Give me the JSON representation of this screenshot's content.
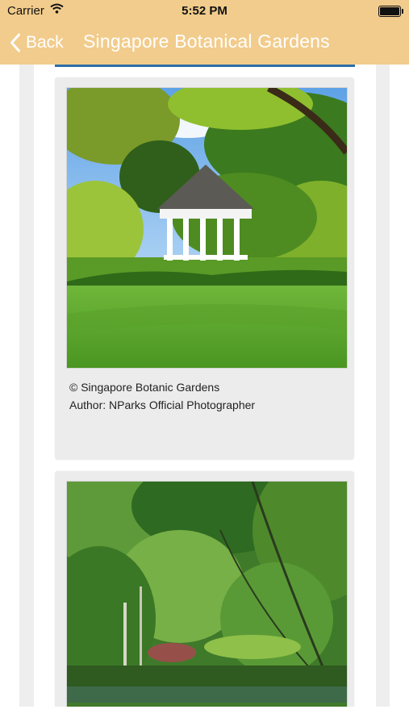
{
  "status_bar": {
    "carrier": "Carrier",
    "time": "5:52 PM"
  },
  "nav": {
    "back_label": "Back",
    "title": "Singapore Botanical Gardens"
  },
  "gallery": [
    {
      "copyright": "© Singapore Botanic Gardens",
      "author": "Author: NParks Official Photographer",
      "image": "gazebo-lawn-photo"
    },
    {
      "image": "lake-forest-photo"
    }
  ],
  "colors": {
    "header": "#f2cc8c",
    "header_text": "#ffffff",
    "accent_line": "#2c6fa6",
    "card_bg": "#ececec"
  }
}
